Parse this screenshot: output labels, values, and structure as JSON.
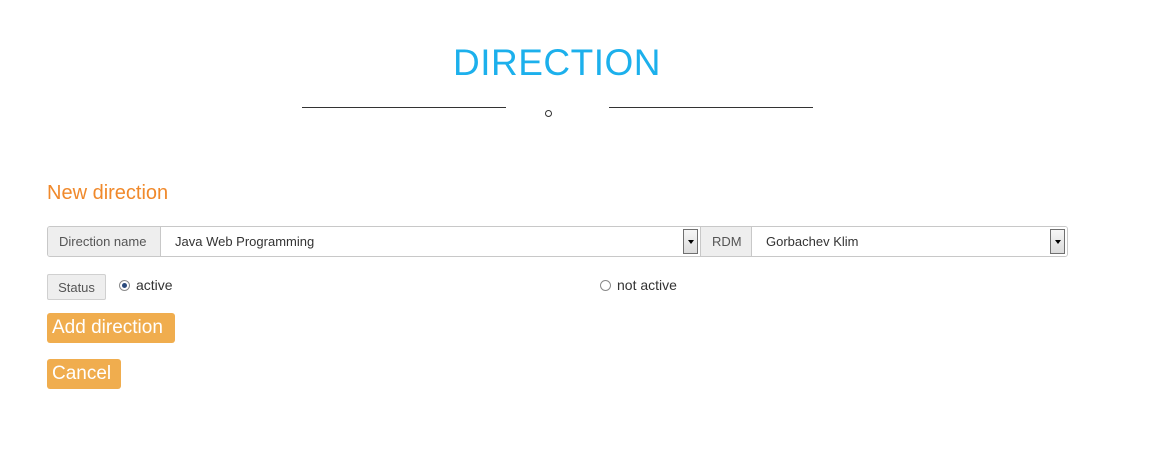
{
  "header": {
    "title": "DIRECTION"
  },
  "form": {
    "section_title": "New direction",
    "direction_name": {
      "label": "Direction name",
      "selected_value": "Java Web Programming"
    },
    "rdm": {
      "label": "RDM",
      "selected_value": "Gorbachev Klim"
    },
    "status": {
      "label": "Status",
      "options": [
        {
          "label": "active",
          "checked": true
        },
        {
          "label": "not active",
          "checked": false
        }
      ]
    },
    "buttons": {
      "add_label": "Add direction",
      "cancel_label": "Cancel"
    }
  },
  "colors": {
    "title": "#1cb0ec",
    "section_title": "#f0892b",
    "button": "#f0ad4e"
  },
  "icons": {
    "divider": "circle-ornament-icon",
    "select_arrow": "chevron-down-icon",
    "radio": "radio-icon"
  }
}
